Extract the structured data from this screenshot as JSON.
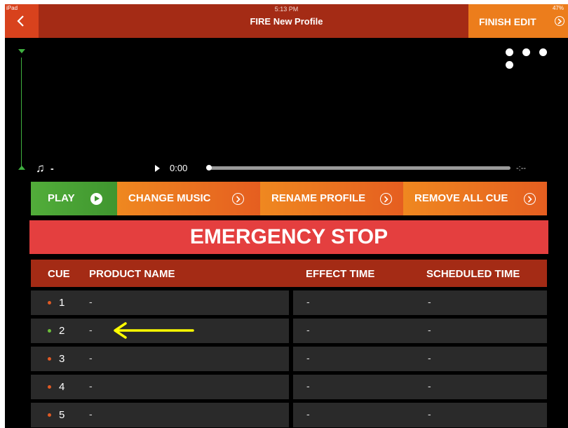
{
  "status": {
    "left": "iPad",
    "time": "5:13 PM",
    "battery": "47%"
  },
  "header": {
    "title": "FIRE New Profile",
    "finish_label": "FINISH EDIT"
  },
  "player": {
    "track": "-",
    "time": "0:00",
    "remaining": "-:--",
    "progress": 0
  },
  "buttons": {
    "play": "PLAY",
    "change_music": "CHANGE MUSIC",
    "rename_profile": "RENAME PROFILE",
    "remove_all_cue": "REMOVE ALL CUE"
  },
  "emergency_stop": "EMERGENCY STOP",
  "table": {
    "headers": [
      "CUE",
      "PRODUCT NAME",
      "EFFECT TIME",
      "SCHEDULED TIME"
    ],
    "rows": [
      {
        "cue": "1",
        "product": "-",
        "effect": "-",
        "scheduled": "-",
        "dot_color": "#e05a24"
      },
      {
        "cue": "2",
        "product": "-",
        "effect": "-",
        "scheduled": "-",
        "dot_color": "#6cbf3a"
      },
      {
        "cue": "3",
        "product": "-",
        "effect": "-",
        "scheduled": "-",
        "dot_color": "#e05a24"
      },
      {
        "cue": "4",
        "product": "-",
        "effect": "-",
        "scheduled": "-",
        "dot_color": "#e05a24"
      },
      {
        "cue": "5",
        "product": "-",
        "effect": "-",
        "scheduled": "-",
        "dot_color": "#e05a24"
      }
    ]
  },
  "colors": {
    "header_red": "#a42b15",
    "accent_orange": "#ec7d1c",
    "play_green": "#52ad3a",
    "stop_red": "#e43f3f",
    "annotation_arrow": "#ffff00"
  }
}
